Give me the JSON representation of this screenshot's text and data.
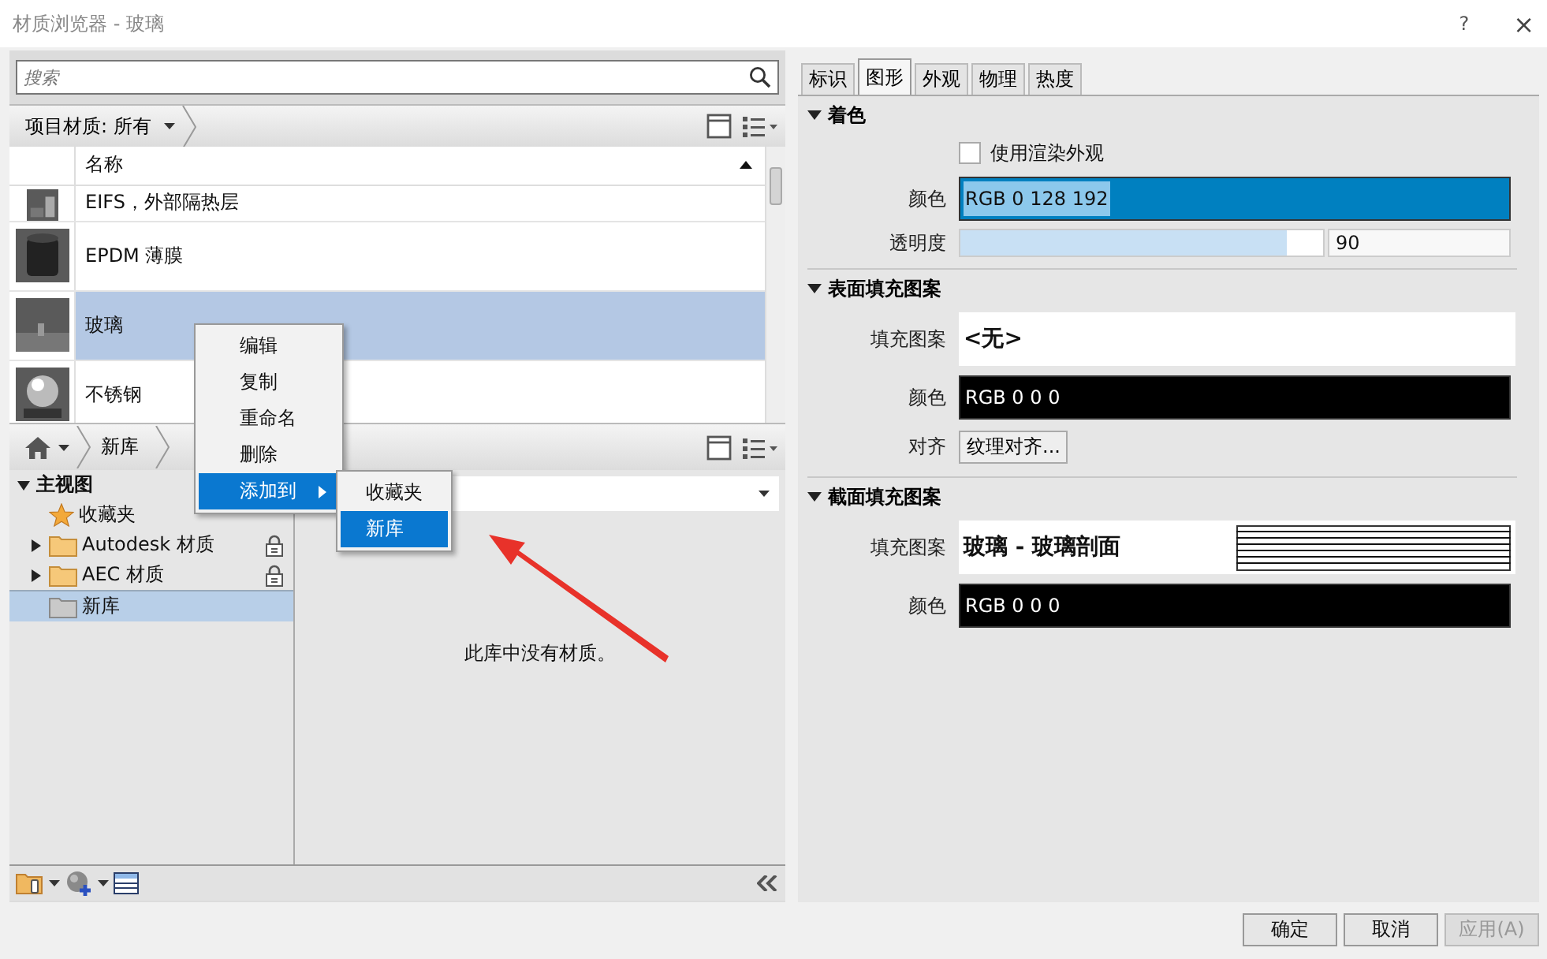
{
  "window": {
    "title": "材质浏览器 - 玻璃",
    "help": "?",
    "close": "×"
  },
  "search": {
    "placeholder": "搜索"
  },
  "material_filter": {
    "label": "项目材质: 所有"
  },
  "material_list": {
    "column": "名称",
    "rows": [
      {
        "name": "EIFS，外部隔热层",
        "kind": "cube",
        "selected": false
      },
      {
        "name": "EPDM 薄膜",
        "kind": "cylinder",
        "selected": false
      },
      {
        "name": "玻璃",
        "kind": "flat",
        "selected": true
      },
      {
        "name": "不锈钢",
        "kind": "sphere",
        "selected": false
      }
    ]
  },
  "library_bar": {
    "crumb": "新库"
  },
  "library_tree": [
    {
      "label": "主视图",
      "kind": "root",
      "expanded": true,
      "selected": false,
      "children": [
        {
          "label": "收藏夹",
          "kind": "favorites",
          "selected": false
        },
        {
          "label": "Autodesk 材质",
          "kind": "folder",
          "expanded": false,
          "locked": true,
          "selected": false
        },
        {
          "label": "AEC 材质",
          "kind": "folder",
          "expanded": false,
          "locked": true,
          "selected": false
        },
        {
          "label": "新库",
          "kind": "library",
          "locked": false,
          "selected": true
        }
      ]
    }
  ],
  "library_content": {
    "empty_message": "此库中没有材质。"
  },
  "context_menu": {
    "items": [
      {
        "label": "编辑",
        "selected": false,
        "submenu": false
      },
      {
        "label": "复制",
        "selected": false,
        "submenu": false
      },
      {
        "label": "重命名",
        "selected": false,
        "submenu": false
      },
      {
        "label": "删除",
        "selected": false,
        "submenu": false
      },
      {
        "label": "添加到",
        "selected": true,
        "submenu": true
      }
    ]
  },
  "submenu": {
    "items": [
      {
        "label": "收藏夹",
        "selected": false
      },
      {
        "label": "新库",
        "selected": true
      }
    ]
  },
  "tabs": [
    {
      "label": "标识",
      "selected": false
    },
    {
      "label": "图形",
      "selected": true
    },
    {
      "label": "外观",
      "selected": false
    },
    {
      "label": "物理",
      "selected": false
    },
    {
      "label": "热度",
      "selected": false
    }
  ],
  "sections": [
    {
      "title": "着色",
      "expanded": true,
      "rows": [
        {
          "kind": "checkbox",
          "label": "使用渲染外观",
          "checked": false
        },
        {
          "kind": "color",
          "label": "颜色",
          "value": "RGB 0 128 192",
          "color": "#0080c0",
          "text_selected": true
        },
        {
          "kind": "slider",
          "label": "透明度",
          "level": 0.9,
          "value": "90"
        }
      ]
    },
    {
      "title": "表面填充图案",
      "expanded": true,
      "rows": [
        {
          "kind": "pattern",
          "label": "填充图案",
          "value": "<无>",
          "hatched": false
        },
        {
          "kind": "color",
          "label": "颜色",
          "value": "RGB 0 0 0",
          "color": "#000000",
          "text_selected": false
        },
        {
          "kind": "button",
          "label": "对齐",
          "value": "纹理对齐..."
        }
      ]
    },
    {
      "title": "截面填充图案",
      "expanded": true,
      "rows": [
        {
          "kind": "pattern",
          "label": "填充图案",
          "value": "玻璃 - 玻璃剖面",
          "hatched": true
        },
        {
          "kind": "color",
          "label": "颜色",
          "value": "RGB 0 0 0",
          "color": "#000000",
          "text_selected": false
        }
      ]
    }
  ],
  "buttons": [
    {
      "label": "确定",
      "disabled": false
    },
    {
      "label": "取消",
      "disabled": false
    },
    {
      "label": "应用(A)",
      "disabled": true
    }
  ]
}
